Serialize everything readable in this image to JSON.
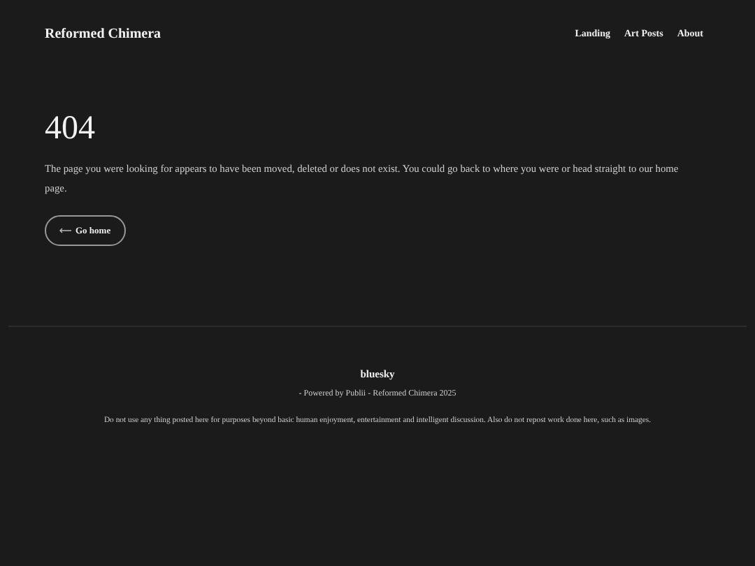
{
  "header": {
    "site_title": "Reformed Chimera",
    "nav": [
      {
        "label": "Landing"
      },
      {
        "label": "Art Posts"
      },
      {
        "label": "About"
      }
    ]
  },
  "main": {
    "heading": "404",
    "message": "The page you were looking for appears to have been moved, deleted or does not exist. You could go back to where you were or head straight to our home page.",
    "button": "Go home"
  },
  "footer": {
    "social": "bluesky",
    "credits": "- Powered by Publii -  Reformed Chimera 2025",
    "disclaimer": "Do not use any thing posted here for purposes beyond basic human enjoyment, entertainment and intelligent discussion.  Also do not repost work done here, such as images."
  }
}
